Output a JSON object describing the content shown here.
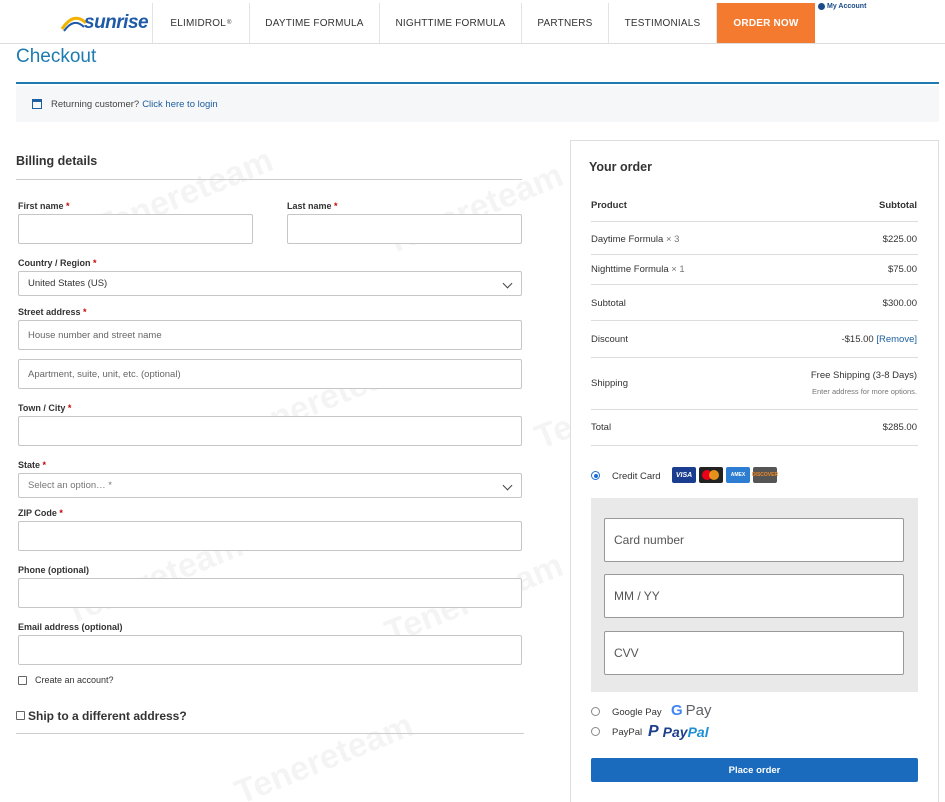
{
  "nav": {
    "logo_text": "sunrise",
    "items": [
      "ELIMIDROL",
      "DAYTIME FORMULA",
      "NIGHTTIME FORMULA",
      "PARTNERS",
      "TESTIMONIALS"
    ],
    "reg_mark": "®",
    "order_now": "ORDER NOW",
    "account": "My Account"
  },
  "page": {
    "title": "Checkout",
    "notice_text": "Returning customer?",
    "notice_link": "Click here to login"
  },
  "billing": {
    "heading": "Billing details",
    "first_name": "First name",
    "last_name": "Last name",
    "country_label": "Country / Region",
    "country_value": "United States (US)",
    "street_label": "Street address",
    "street_placeholder": "House number and street name",
    "apt_placeholder": "Apartment, suite, unit, etc. (optional)",
    "city_label": "Town / City",
    "state_label": "State",
    "state_placeholder": "Select an option… *",
    "zip_label": "ZIP Code",
    "phone_label": "Phone (optional)",
    "email_label": "Email address (optional)",
    "create_account": "Create an account?",
    "ship_different": "Ship to a different address?",
    "required_mark": "*"
  },
  "order": {
    "heading": "Your order",
    "col_product": "Product",
    "col_subtotal": "Subtotal",
    "items": [
      {
        "name": "Daytime Formula",
        "qty": "× 3",
        "price": "$225.00"
      },
      {
        "name": "Nighttime Formula",
        "qty": "× 1",
        "price": "$75.00"
      }
    ],
    "subtotal_label": "Subtotal",
    "subtotal_value": "$300.00",
    "discount_label": "Discount",
    "discount_value": "-$15.00",
    "discount_remove": "[Remove]",
    "shipping_label": "Shipping",
    "shipping_value": "Free Shipping (3-8 Days)",
    "shipping_note": "Enter address for more options.",
    "total_label": "Total",
    "total_value": "$285.00"
  },
  "payment": {
    "credit_card": "Credit Card",
    "card_brands": [
      "VISA",
      "MC",
      "AMEX",
      "DISCOVER"
    ],
    "card_number": "Card number",
    "expiry": "MM / YY",
    "cvv": "CVV",
    "google_pay": "Google Pay",
    "google_pay_mark": "Pay",
    "paypal": "PayPal",
    "paypal_mark_a": "Pay",
    "paypal_mark_b": "Pal",
    "place_order": "Place order"
  },
  "watermark": "Tenereteam"
}
